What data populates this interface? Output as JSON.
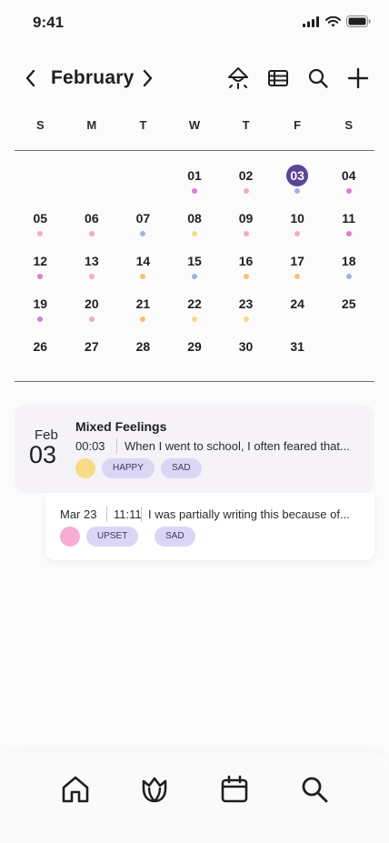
{
  "status_bar": {
    "time": "9:41"
  },
  "header": {
    "month": "February"
  },
  "weekdays": [
    "S",
    "M",
    "T",
    "W",
    "T",
    "F",
    "S"
  ],
  "calendar": {
    "leading_blanks": 3,
    "selected": "03",
    "days": [
      {
        "label": "01",
        "dot": "#d97fcf"
      },
      {
        "label": "02",
        "dot": "#f5a9c8"
      },
      {
        "label": "03",
        "dot": "#9fb2e6"
      },
      {
        "label": "04",
        "dot": "#d97fcf"
      },
      {
        "label": "05",
        "dot": "#f5a9c8"
      },
      {
        "label": "06",
        "dot": "#f5a9c8"
      },
      {
        "label": "07",
        "dot": "#9fb2e6"
      },
      {
        "label": "08",
        "dot": "#f7d98a"
      },
      {
        "label": "09",
        "dot": "#f5a9c8"
      },
      {
        "label": "10",
        "dot": "#f5a9c8"
      },
      {
        "label": "11",
        "dot": "#d97fcf"
      },
      {
        "label": "12",
        "dot": "#d97fcf"
      },
      {
        "label": "13",
        "dot": "#f5a9c8"
      },
      {
        "label": "14",
        "dot": "#f5c07a"
      },
      {
        "label": "15",
        "dot": "#9fb2e6"
      },
      {
        "label": "16",
        "dot": "#f5c07a"
      },
      {
        "label": "17",
        "dot": "#f5c07a"
      },
      {
        "label": "18",
        "dot": "#9fb2e6"
      },
      {
        "label": "19",
        "dot": "#d97fcf"
      },
      {
        "label": "20",
        "dot": "#f5a9c8"
      },
      {
        "label": "21",
        "dot": "#f5c07a"
      },
      {
        "label": "22",
        "dot": "#f7d98a"
      },
      {
        "label": "23",
        "dot": "#f7d98a"
      },
      {
        "label": "24",
        "dot": null
      },
      {
        "label": "25",
        "dot": null
      },
      {
        "label": "26",
        "dot": null
      },
      {
        "label": "27",
        "dot": null
      },
      {
        "label": "28",
        "dot": null
      },
      {
        "label": "29",
        "dot": null
      },
      {
        "label": "30",
        "dot": null
      },
      {
        "label": "31",
        "dot": null
      }
    ]
  },
  "entry": {
    "month": "Feb",
    "day": "03",
    "title": "Mixed Feelings",
    "time": "00:03",
    "text": "When I went to school, I often feared that...",
    "mood_color": "#f7dc85",
    "tags": [
      "HAPPY",
      "SAD"
    ]
  },
  "sub_entry": {
    "date": "Mar 23",
    "time": "11:11",
    "text": "I was partially writing this because of...",
    "mood_color": "#f7acd2",
    "tags": [
      "UPSET",
      "SAD"
    ]
  },
  "colors": {
    "accent": "#5b4596",
    "tag_bg": "#dcd6f6",
    "card_bg": "#f5f2f8"
  },
  "tabs": [
    "home-icon",
    "lotus-icon",
    "calendar-icon",
    "search-icon"
  ]
}
